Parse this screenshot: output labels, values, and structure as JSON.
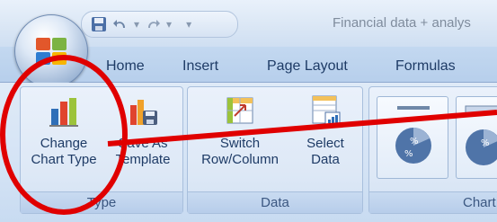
{
  "window": {
    "title": "Financial data + analys"
  },
  "qat": {
    "dropdown_glyph": "▾"
  },
  "tabs": [
    {
      "label": "Home"
    },
    {
      "label": "Insert"
    },
    {
      "label": "Page Layout"
    },
    {
      "label": "Formulas"
    }
  ],
  "groups": {
    "type": {
      "label": "Type",
      "change_chart_type": {
        "line1": "Change",
        "line2": "Chart Type"
      },
      "save_as_template": {
        "line1": "Save As",
        "line2": "Template"
      }
    },
    "data": {
      "label": "Data",
      "switch_row_column": {
        "line1": "Switch",
        "line2": "Row/Column"
      },
      "select_data": {
        "line1": "Select",
        "line2": "Data"
      }
    },
    "chart_styles": {
      "label": "Chart"
    }
  },
  "colors": {
    "annotation": "#e00000",
    "tab_text": "#1e3b66",
    "group_label": "#3b5781"
  }
}
